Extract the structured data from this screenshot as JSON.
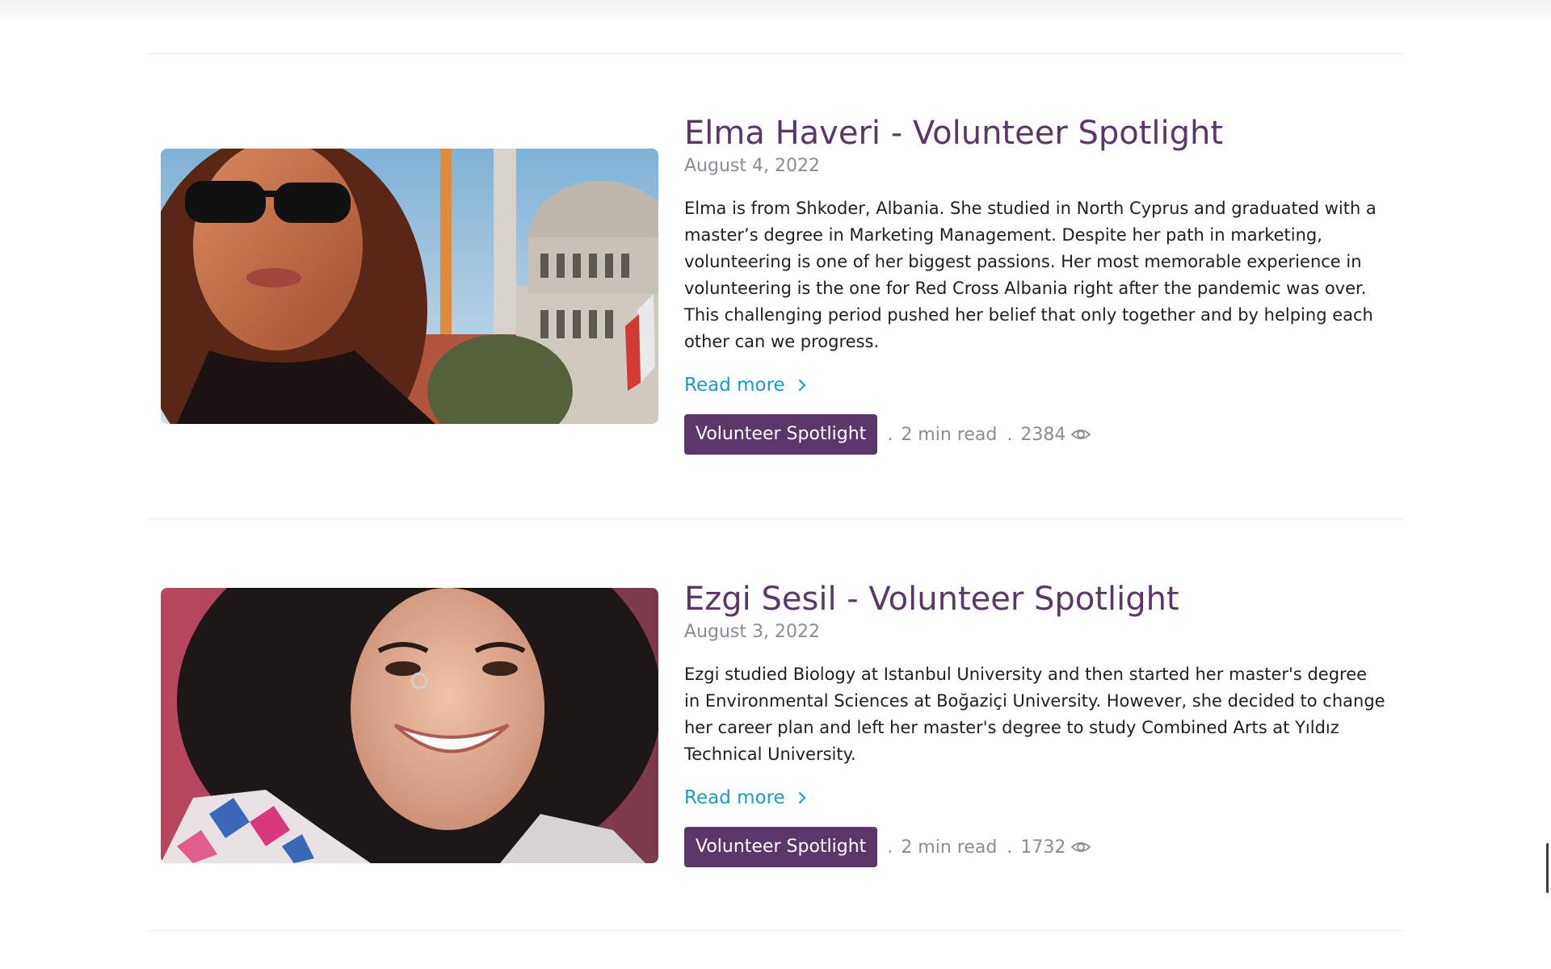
{
  "posts": [
    {
      "title": "Elma Haveri - Volunteer Spotlight",
      "date": "August 4, 2022",
      "excerpt": "Elma is from Shkoder, Albania. She studied in North Cyprus and graduated with a master’s degree in Marketing Management. Despite her path in marketing, volunteering is one of her biggest passions. Her most memorable experience in volunteering is the one for Red Cross Albania right after the pandemic was over. This challenging period pushed her belief that only together and by helping each other can we progress.",
      "read_more": "Read more",
      "category": "Volunteer Spotlight",
      "read_time": "2 min read",
      "views": "2384"
    },
    {
      "title": "Ezgi Sesil - Volunteer Spotlight",
      "date": "August 3, 2022",
      "excerpt": "Ezgi studied Biology at Istanbul University and then started her master's degree in Environmental Sciences at Boğaziçi University. However, she decided to change her career plan and left her master's degree to study Combined Arts at Yıldız Technical University.",
      "read_more": "Read more",
      "category": "Volunteer Spotlight",
      "read_time": "2 min read",
      "views": "1732"
    }
  ],
  "separator": ".",
  "colors": {
    "title": "#5a3768",
    "tag_bg": "#5a3768",
    "link": "#1a9bc6",
    "muted": "#8a8d93"
  },
  "icons": {
    "read_more": "chevron-right-icon",
    "views": "eye-icon"
  }
}
